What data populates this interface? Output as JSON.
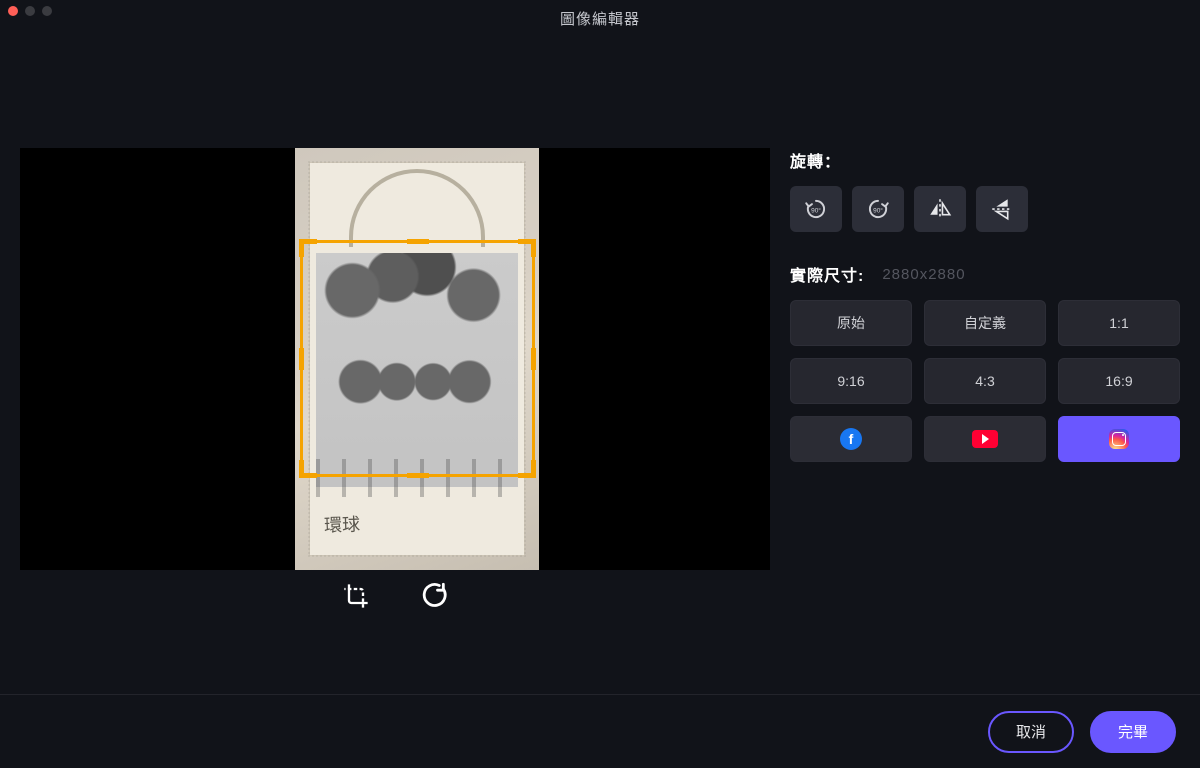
{
  "app": {
    "title": "圖像編輯器"
  },
  "rotate": {
    "label": "旋轉：",
    "ccw_badge": "90°",
    "cw_badge": "90°"
  },
  "size": {
    "label": "實際尺寸:",
    "dimensions": "2880x2880"
  },
  "ratios": {
    "original": "原始",
    "custom": "自定義",
    "one_one": "1:1",
    "nine_sixteen": "9:16",
    "four_three": "4:3",
    "sixteen_nine": "16:9"
  },
  "photo": {
    "watermark": "環球"
  },
  "footer": {
    "cancel": "取消",
    "done": "完畢"
  },
  "colors": {
    "accent": "#6a57ff",
    "crop": "#f5a300"
  }
}
